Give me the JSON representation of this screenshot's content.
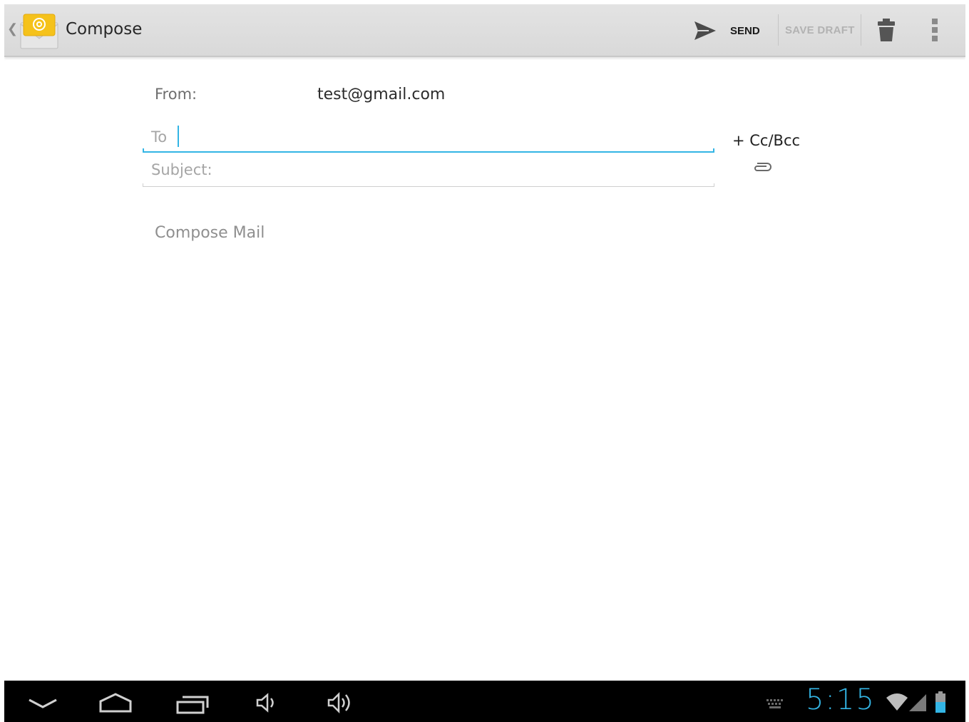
{
  "action_bar": {
    "title": "Compose",
    "send_label": "SEND",
    "save_draft_label": "SAVE DRAFT",
    "icons": [
      "email-app-icon",
      "send-icon",
      "trash-icon",
      "overflow-menu-icon"
    ]
  },
  "form": {
    "from_label": "From:",
    "from_value": "test@gmail.com",
    "to_placeholder": "To",
    "cc_bcc_label": "+ Cc/Bcc",
    "subject_placeholder": "Subject:",
    "body_placeholder": "Compose Mail"
  },
  "system_bar": {
    "time": "5:15",
    "nav_icons": [
      "hide-keyboard-icon",
      "home-icon",
      "recent-apps-icon",
      "volume-down-icon",
      "volume-up-icon"
    ],
    "status_icons": [
      "keyboard-icon",
      "wifi-icon",
      "signal-icon",
      "battery-icon"
    ]
  },
  "colors": {
    "accent": "#33b5e5",
    "action_bar_bg": "#dddddd",
    "system_bar_bg": "#000000"
  }
}
